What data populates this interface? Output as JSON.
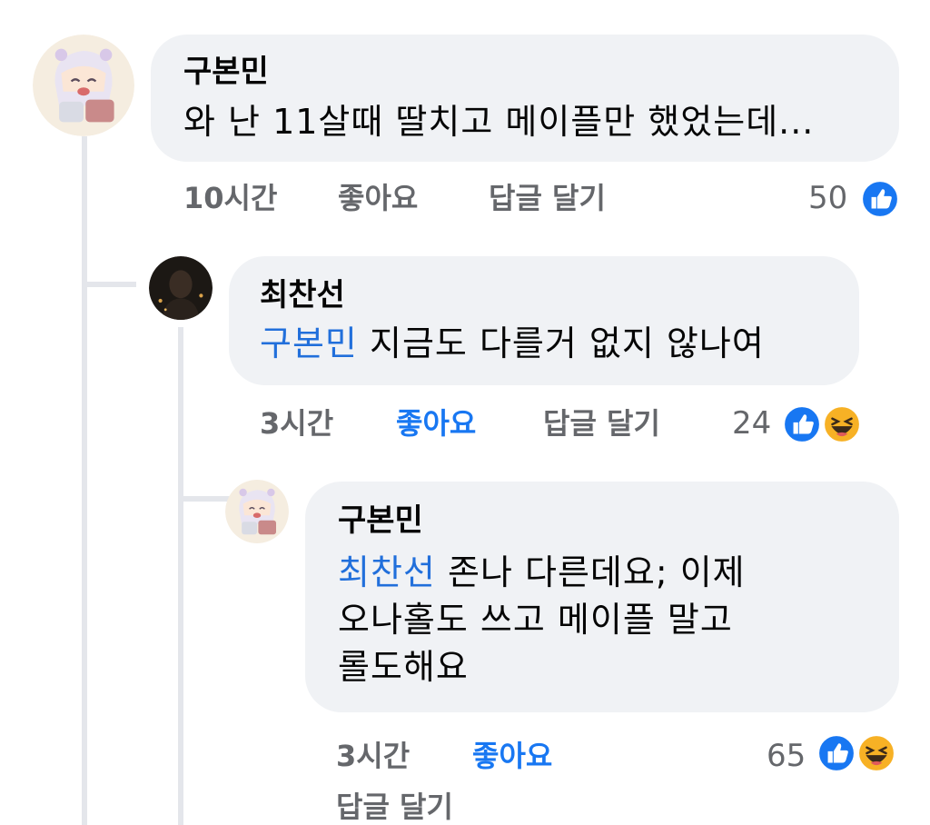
{
  "comments": [
    {
      "author": "구본민",
      "text": "와 난 11살때 딸치고 메이플만 했었는데...",
      "time": "10시간",
      "like_label": "좋아요",
      "reply_label": "답글 달기",
      "reaction_count": "50",
      "reactions": [
        "like-icon"
      ],
      "liked": false,
      "avatar": "anime-avatar"
    },
    {
      "author": "최찬선",
      "mention": "구본민",
      "text": "지금도 다를거 없지 않나여",
      "time": "3시간",
      "like_label": "좋아요",
      "reply_label": "답글 달기",
      "reaction_count": "24",
      "reactions": [
        "like-icon",
        "haha-icon"
      ],
      "liked": true,
      "avatar": "dark-photo-avatar"
    },
    {
      "author": "구본민",
      "mention": "최찬선",
      "text_line1": "존나 다른데요; 이제",
      "text_line2": "오나홀도 쓰고 메이플 말고",
      "text_line3": "롤도해요",
      "time": "3시간",
      "like_label": "좋아요",
      "reply_label": "답글 달기",
      "reaction_count": "65",
      "reactions": [
        "like-icon",
        "haha-icon"
      ],
      "liked": true,
      "avatar": "anime-avatar"
    }
  ],
  "colors": {
    "bubble": "#f0f2f5",
    "mention": "#216fdb",
    "like_active": "#1877f2",
    "meta_text": "#65676b"
  }
}
